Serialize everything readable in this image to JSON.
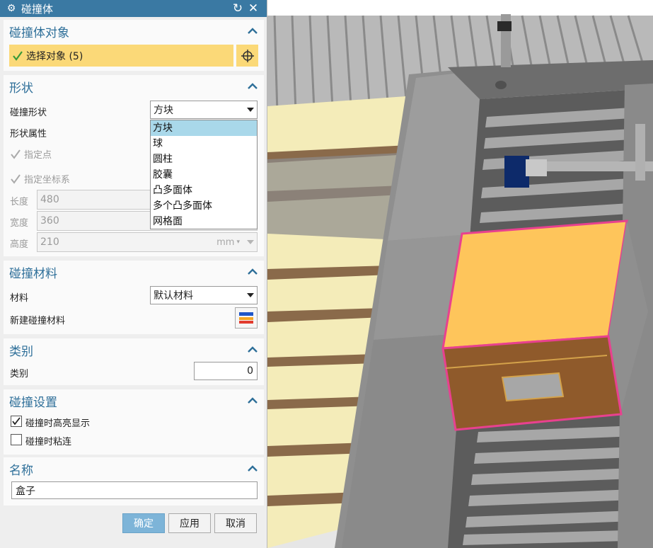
{
  "dialog": {
    "title": "碰撞体",
    "title_icon": "gear-icon",
    "sections": {
      "object": {
        "header": "碰撞体对象",
        "select_label": "选择对象 (5)"
      },
      "shape": {
        "header": "形状",
        "shape_label": "碰撞形状",
        "shape_value": "方块",
        "shape_props_label": "形状属性",
        "specify_point": "指定点",
        "specify_csys": "指定坐标系",
        "length_label": "长度",
        "length_value": "480",
        "width_label": "宽度",
        "width_value": "360",
        "height_label": "高度",
        "height_value": "210",
        "unit": "mm",
        "options": [
          "方块",
          "球",
          "圆柱",
          "胶囊",
          "凸多面体",
          "多个凸多面体",
          "网格面"
        ],
        "selected_option": "方块"
      },
      "material": {
        "header": "碰撞材料",
        "material_label": "材料",
        "material_value": "默认材料",
        "new_material_label": "新建碰撞材料"
      },
      "category": {
        "header": "类别",
        "category_label": "类别",
        "category_value": "0"
      },
      "settings": {
        "header": "碰撞设置",
        "highlight_label": "碰撞时高亮显示",
        "highlight_checked": true,
        "stick_label": "碰撞时粘连",
        "stick_checked": false
      },
      "name": {
        "header": "名称",
        "name_value": "盒子"
      }
    },
    "buttons": {
      "ok": "确定",
      "apply": "应用",
      "cancel": "取消"
    }
  },
  "colors": {
    "titlebar": "#3a79a3",
    "section_header": "#2e6f99",
    "selection_bar": "#fbd978",
    "dropdown_selected": "#a9d8ea",
    "box_top": "#fec55b",
    "box_body": "#8f5a2b",
    "box_outline": "#e8418f"
  }
}
